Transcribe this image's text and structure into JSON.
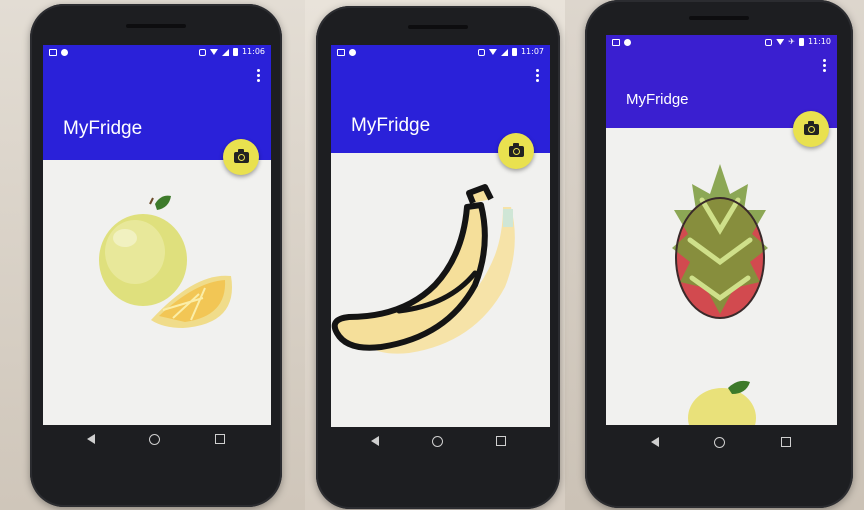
{
  "app_title": "MyFridge",
  "colors": {
    "primary": "#2a21d9",
    "primary_alt": "#3a1fd0",
    "fab": "#e9e14f",
    "screen_bg": "#f1f1ef"
  },
  "screens": [
    {
      "status_time": "11:06",
      "fruit_icon": "pomelo-icon"
    },
    {
      "status_time": "11:07",
      "fruit_icon": "banana-icon"
    },
    {
      "status_time": "11:10",
      "fruit_icon": "dragonfruit-icon"
    }
  ],
  "icons": {
    "fab": "camera-icon",
    "overflow": "more-vert-icon",
    "nav": [
      "back-icon",
      "home-icon",
      "recents-icon"
    ]
  }
}
